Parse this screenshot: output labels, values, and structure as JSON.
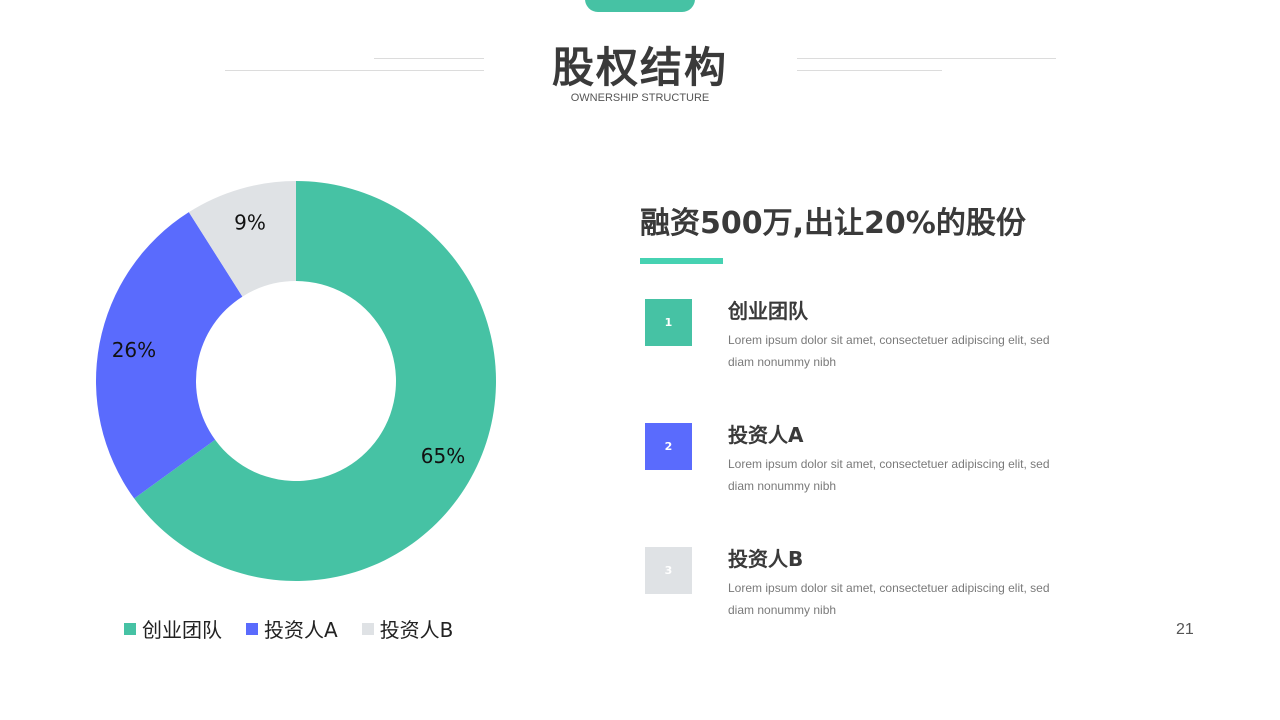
{
  "header": {
    "title": "股权结构",
    "subtitle": "OWNERSHIP STRUCTURE"
  },
  "colors": {
    "accent": "#46c2a4",
    "team": "#46c2a4",
    "investor_a": "#5a6bfd",
    "investor_b": "#dfe2e5"
  },
  "chart_data": {
    "type": "pie",
    "donut": true,
    "categories": [
      "创业团队",
      "投资人A",
      "投资人B"
    ],
    "values": [
      65,
      26,
      9
    ],
    "labels": [
      "65%",
      "26%",
      "9%"
    ],
    "colors": [
      "#46c2a4",
      "#5a6bfd",
      "#dfe2e5"
    ],
    "legend": "bottom"
  },
  "headline": "融资500万,出让20%的股份",
  "items": [
    {
      "number": "1",
      "title": "创业团队",
      "desc": "Lorem ipsum dolor sit amet, consectetuer adipiscing elit, sed diam nonummy nibh",
      "color": "#46c2a4"
    },
    {
      "number": "2",
      "title": "投资人A",
      "desc": "Lorem ipsum dolor sit amet, consectetuer adipiscing elit, sed diam nonummy nibh",
      "color": "#5a6bfd"
    },
    {
      "number": "3",
      "title": "投资人B",
      "desc": "Lorem ipsum dolor sit amet, consectetuer adipiscing elit, sed diam nonummy nibh",
      "color": "#dfe2e5"
    }
  ],
  "page_number": "21"
}
